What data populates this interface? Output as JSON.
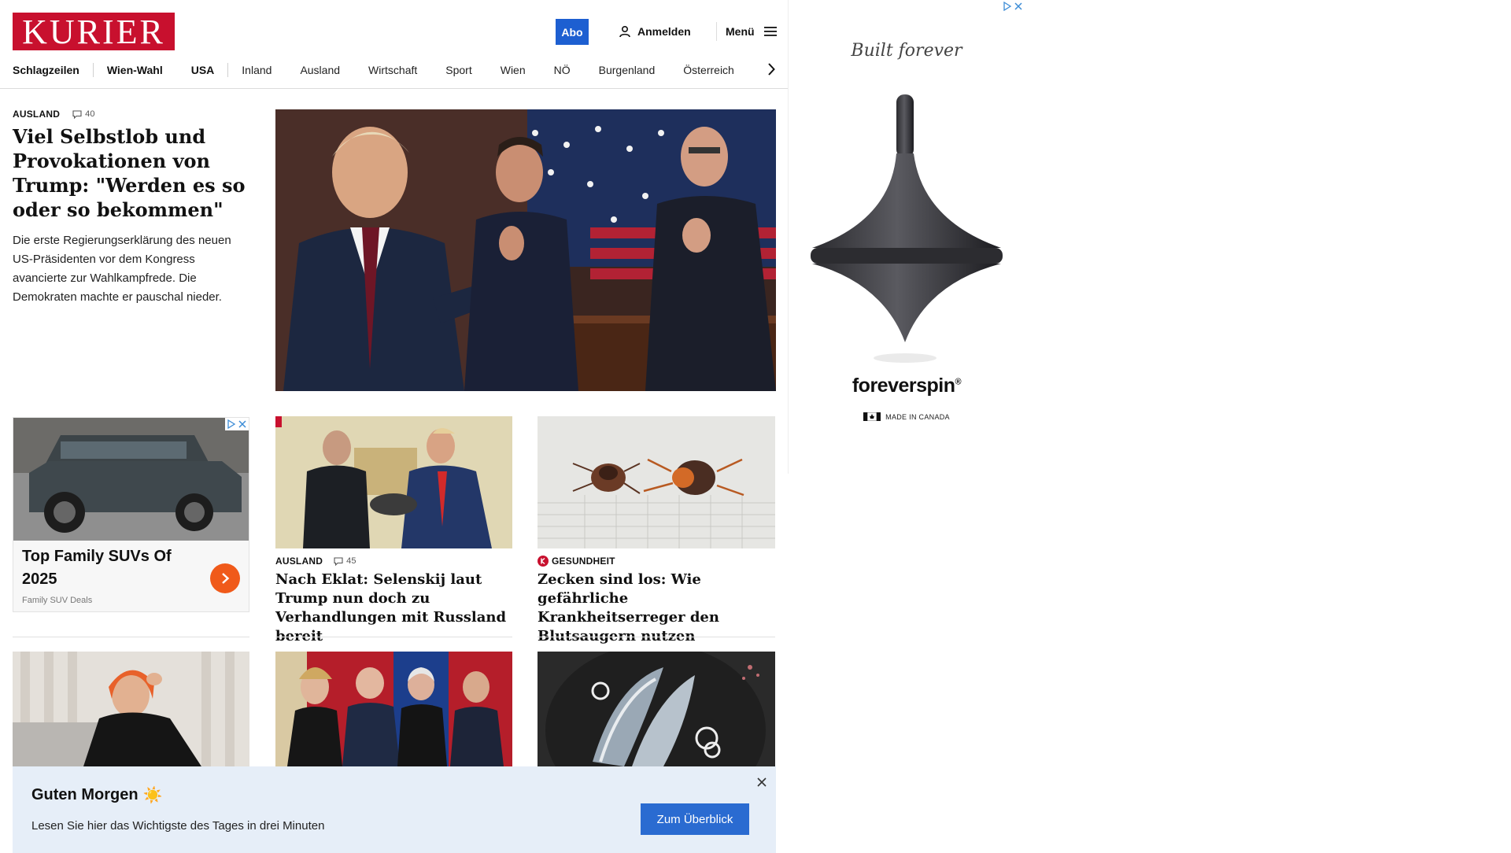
{
  "header": {
    "logo_text": "KURIER",
    "abo_label": "Abo",
    "login_label": "Anmelden",
    "menu_label": "Menü"
  },
  "nav": {
    "items": [
      "Schlagzeilen",
      "Wien-Wahl",
      "USA",
      "Inland",
      "Ausland",
      "Wirtschaft",
      "Sport",
      "Wien",
      "NÖ",
      "Burgenland",
      "Österreich"
    ]
  },
  "lead": {
    "kicker": "AUSLAND",
    "comments": "40",
    "title": "Viel Selbstlob und Provokationen von Trump: \"Werden es so oder so bekommen\"",
    "summary": "Die erste Regierungserklärung des neuen US-Präsidenten vor dem Kongress avancierte zur Wahlkampfrede. Die Demokraten machte er pauschal nieder."
  },
  "ad_card": {
    "title": "Top Family SUVs Of 2025",
    "source": "Family SUV Deals"
  },
  "cards": [
    {
      "kicker": "AUSLAND",
      "comments": "45",
      "title": "Nach Eklat: Selenskij laut Trump nun doch zu Verhandlungen mit Russland bereit"
    },
    {
      "kicker": "GESUNDHEIT",
      "title": "Zecken sind los: Wie gefährliche Krankheitserreger den Blutsaugern nutzen"
    }
  ],
  "right_ad": {
    "tagline": "Built forever",
    "brand": "foreverspin",
    "registered": "®",
    "origin": "MADE IN CANADA"
  },
  "banner": {
    "title": "Guten Morgen",
    "title_emoji": "☀️",
    "text": "Lesen Sie hier das Wichtigste des Tages in drei Minuten",
    "cta": "Zum Überblick"
  },
  "colors": {
    "brand_red": "#c8102e",
    "abo_blue": "#1d5fd1",
    "banner_bg": "#e6eef8",
    "cta_blue": "#2a6bd1",
    "ad_cta_orange": "#f05a1a"
  }
}
